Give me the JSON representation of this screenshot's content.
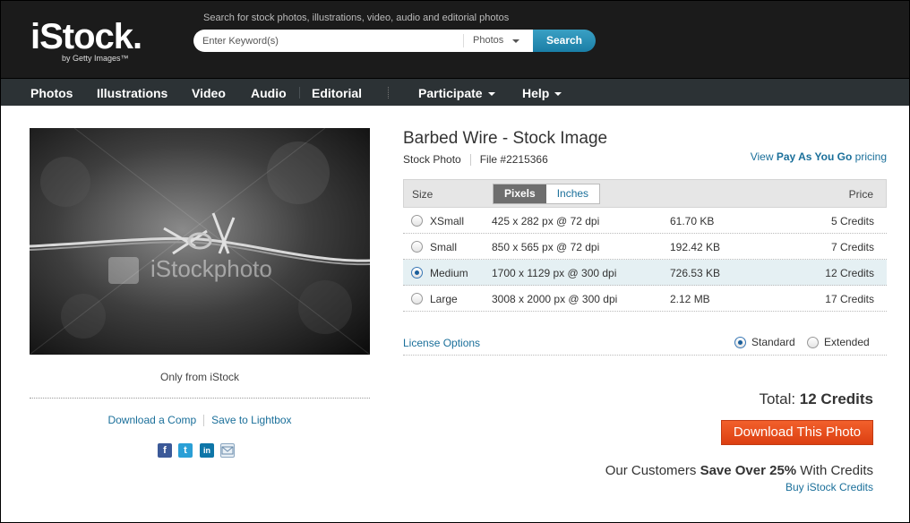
{
  "header": {
    "logo_main": "iStock.",
    "logo_sub": "by Getty Images™",
    "search_hint": "Search for stock photos, illustrations, video, audio and editorial photos",
    "search_placeholder": "Enter Keyword(s)",
    "search_type": "Photos",
    "search_button": "Search"
  },
  "nav": {
    "items": [
      "Photos",
      "Illustrations",
      "Video",
      "Audio",
      "Editorial"
    ],
    "participate": "Participate",
    "help": "Help"
  },
  "photo": {
    "watermark": "iStockphoto",
    "caption": "Only from iStock",
    "download_comp": "Download a Comp",
    "save_lightbox": "Save to Lightbox",
    "social_icons": [
      "facebook-icon",
      "twitter-icon",
      "linkedin-icon",
      "email-icon"
    ]
  },
  "details": {
    "title": "Barbed Wire - Stock Image",
    "type": "Stock Photo",
    "file": "File #2215366",
    "payg_prefix": "View ",
    "payg_bold": "Pay As You Go",
    "payg_suffix": " pricing"
  },
  "size_table": {
    "col_size": "Size",
    "col_price": "Price",
    "unit_pixels": "Pixels",
    "unit_inches": "Inches",
    "rows": [
      {
        "name": "XSmall",
        "dims": "425 x 282 px @ 72 dpi",
        "filesize": "61.70 KB",
        "price": "5 Credits",
        "selected": false
      },
      {
        "name": "Small",
        "dims": "850 x 565 px @ 72 dpi",
        "filesize": "192.42 KB",
        "price": "7 Credits",
        "selected": false
      },
      {
        "name": "Medium",
        "dims": "1700 x 1129 px @ 300 dpi",
        "filesize": "726.53 KB",
        "price": "12 Credits",
        "selected": true
      },
      {
        "name": "Large",
        "dims": "3008 x 2000 px @ 300 dpi",
        "filesize": "2.12 MB",
        "price": "17 Credits",
        "selected": false
      }
    ]
  },
  "license": {
    "link": "License Options",
    "standard": "Standard",
    "extended": "Extended"
  },
  "purchase": {
    "total_label": "Total: ",
    "total_value": "12 Credits",
    "download_button": "Download This Photo",
    "save_prefix": "Our Customers ",
    "save_bold": "Save Over 25%",
    "save_suffix": " With Credits",
    "buy_credits": "Buy iStock Credits"
  },
  "colors": {
    "link": "#1a6f9a",
    "search_button": "#1a7ea6",
    "download_button": "#dc3f12",
    "header_bg": "#1b1b1b",
    "nav_bg": "#2c3235"
  }
}
